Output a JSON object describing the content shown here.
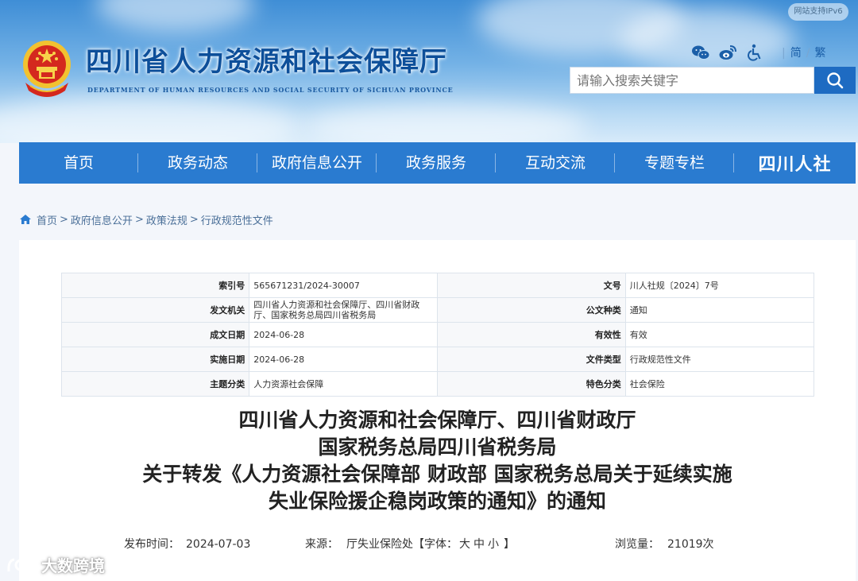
{
  "header": {
    "ipv6_badge": "网站支持IPv6",
    "site_title": "四川省人力资源和社会保障厅",
    "site_subtitle": "DEPARTMENT OF HUMAN RESOURCES AND SOCIAL SECURITY OF SICHUAN PROVINCE",
    "icons": [
      "wechat-icon",
      "weibo-icon",
      "accessibility-icon"
    ],
    "lang_simplified": "简",
    "lang_separator": "/",
    "lang_traditional": "繁",
    "search_placeholder": "请输入搜索关键字"
  },
  "nav": {
    "items": [
      "首页",
      "政务动态",
      "政府信息公开",
      "政务服务",
      "互动交流",
      "专题专栏"
    ],
    "brand": "四川人社"
  },
  "breadcrumb": [
    "首页",
    "政府信息公开",
    "政策法规",
    "行政规范性文件"
  ],
  "meta": {
    "rows": [
      {
        "k1": "索引号",
        "v1": "565671231/2024-30007",
        "k2": "文号",
        "v2": "川人社规〔2024〕7号"
      },
      {
        "k1": "发文机关",
        "v1": "四川省人力资源和社会保障厅、四川省财政厅、国家税务总局四川省税务局",
        "k2": "公文种类",
        "v2": "通知"
      },
      {
        "k1": "成文日期",
        "v1": "2024-06-28",
        "k2": "有效性",
        "v2": "有效"
      },
      {
        "k1": "实施日期",
        "v1": "2024-06-28",
        "k2": "文件类型",
        "v2": "行政规范性文件"
      },
      {
        "k1": "主题分类",
        "v1": "人力资源社会保障",
        "k2": "特色分类",
        "v2": "社会保险"
      }
    ]
  },
  "doc_title": [
    "四川省人力资源和社会保障厅、四川省财政厅",
    "国家税务总局四川省税务局",
    "关于转发《人力资源社会保障部 财政部 国家税务总局关于延续实施",
    "失业保险援企稳岗政策的通知》的通知"
  ],
  "info": {
    "publish_label": "发布时间：",
    "publish_date": "2024-07-03",
    "source_label": "来源：",
    "source": "厅失业保险处",
    "font_label": "【字体：",
    "font_large": "大",
    "font_medium": "中",
    "font_small": "小",
    "font_end": "】",
    "views_label": "浏览量：",
    "views": "21019次"
  },
  "watermark": "大数跨境",
  "colors": {
    "nav_bg": "#2a7bd0",
    "title_blue": "#0d4f9a",
    "search_btn": "#1e6bc2"
  }
}
